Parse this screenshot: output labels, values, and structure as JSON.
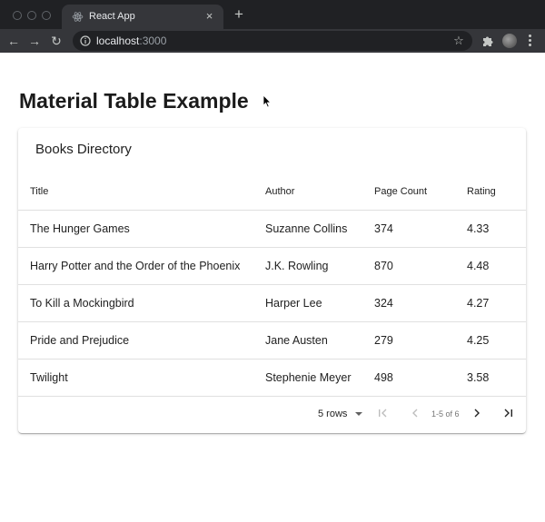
{
  "browser": {
    "tab": {
      "title": "React App",
      "close_glyph": "×"
    },
    "new_tab_glyph": "+",
    "nav": {
      "back_glyph": "←",
      "forward_glyph": "→",
      "reload_glyph": "↻"
    },
    "address": {
      "host": "localhost",
      "port": ":3000"
    },
    "bookmark_glyph": "☆",
    "icons": {
      "favicon": "react-logo-icon",
      "site": "info-icon",
      "extensions": "puzzle-icon"
    }
  },
  "page": {
    "title": "Material Table Example"
  },
  "table": {
    "title": "Books Directory",
    "columns": [
      "Title",
      "Author",
      "Page Count",
      "Rating"
    ],
    "rows": [
      [
        "The Hunger Games",
        "Suzanne Collins",
        "374",
        "4.33"
      ],
      [
        "Harry Potter and the Order of the Phoenix",
        "J.K. Rowling",
        "870",
        "4.48"
      ],
      [
        "To Kill a Mockingbird",
        "Harper Lee",
        "324",
        "4.27"
      ],
      [
        "Pride and Prejudice",
        "Jane Austen",
        "279",
        "4.25"
      ],
      [
        "Twilight",
        "Stephenie Meyer",
        "498",
        "3.58"
      ]
    ]
  },
  "pagination": {
    "rows_per_page": "5 rows",
    "range": "1-5 of 6"
  },
  "colors": {
    "chrome_dark": "#202124",
    "chrome_toolbar": "#35363a",
    "divider": "#e0e0e0",
    "text": "#212121"
  }
}
